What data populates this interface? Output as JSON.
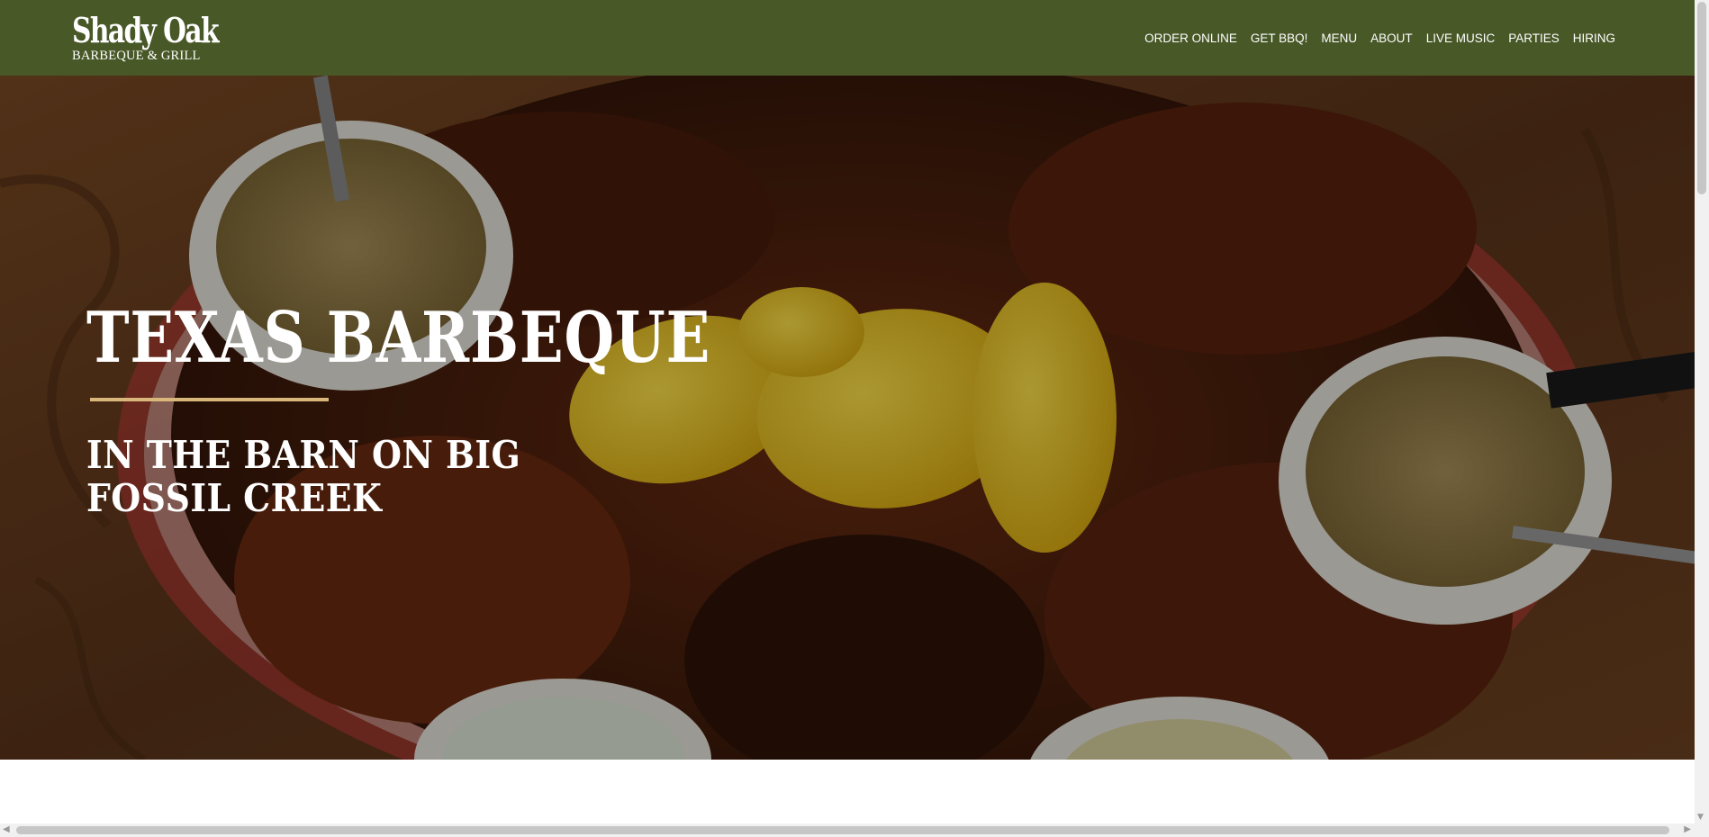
{
  "brand": {
    "name": "Shady Oak",
    "tagline": "BARBEQUE & GRILL"
  },
  "nav": {
    "items": [
      {
        "label": "ORDER ONLINE"
      },
      {
        "label": "GET BBQ!"
      },
      {
        "label": "MENU"
      },
      {
        "label": "ABOUT"
      },
      {
        "label": "LIVE MUSIC"
      },
      {
        "label": "PARTIES"
      },
      {
        "label": "HIRING"
      }
    ]
  },
  "hero": {
    "title": "TEXAS BARBEQUE",
    "subtitle": "IN THE BARN ON BIG FOSSIL CREEK",
    "image_subject": "barbeque-platter-photo"
  },
  "colors": {
    "header_bg": "#485827",
    "accent_rule": "#d9b77a",
    "text": "#ffffff"
  },
  "icons": {
    "scroll_down": "▼",
    "scroll_left": "◀",
    "scroll_right": "▶"
  }
}
